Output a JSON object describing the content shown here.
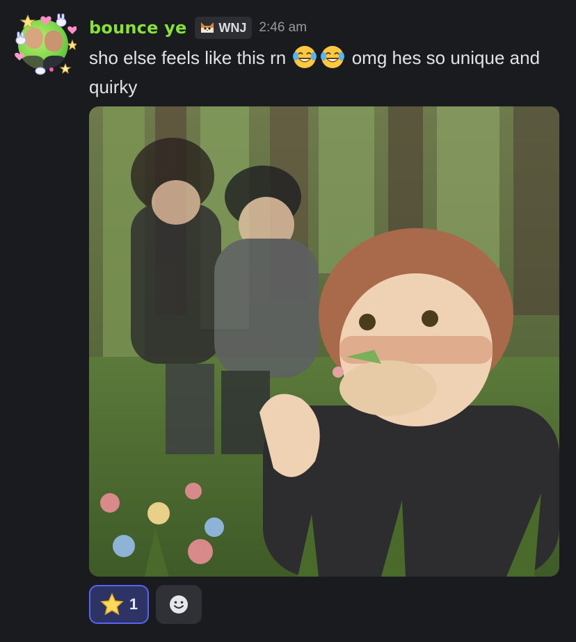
{
  "message": {
    "username": "bounce ye",
    "username_color": "#86e13a",
    "tag": {
      "icon": "cat-icon",
      "label": "WNJ"
    },
    "timestamp": "2:46 am",
    "text_before": "sho else feels like this rn",
    "emojis": [
      "joy-emoji",
      "joy-emoji"
    ],
    "text_after": "omg hes so unique and quirky",
    "attachment": {
      "type": "image",
      "description_icon": "illustration-image"
    },
    "reactions": [
      {
        "emoji": "star-emoji",
        "count": "1",
        "active": true
      }
    ],
    "add_reaction_icon": "smiley-add-icon"
  },
  "colors": {
    "background": "#1a1b1e",
    "text": "#e1e2e6",
    "timestamp": "#989aa2",
    "reaction_active_border": "#5865f2",
    "reaction_active_bg": "#2e3366"
  }
}
